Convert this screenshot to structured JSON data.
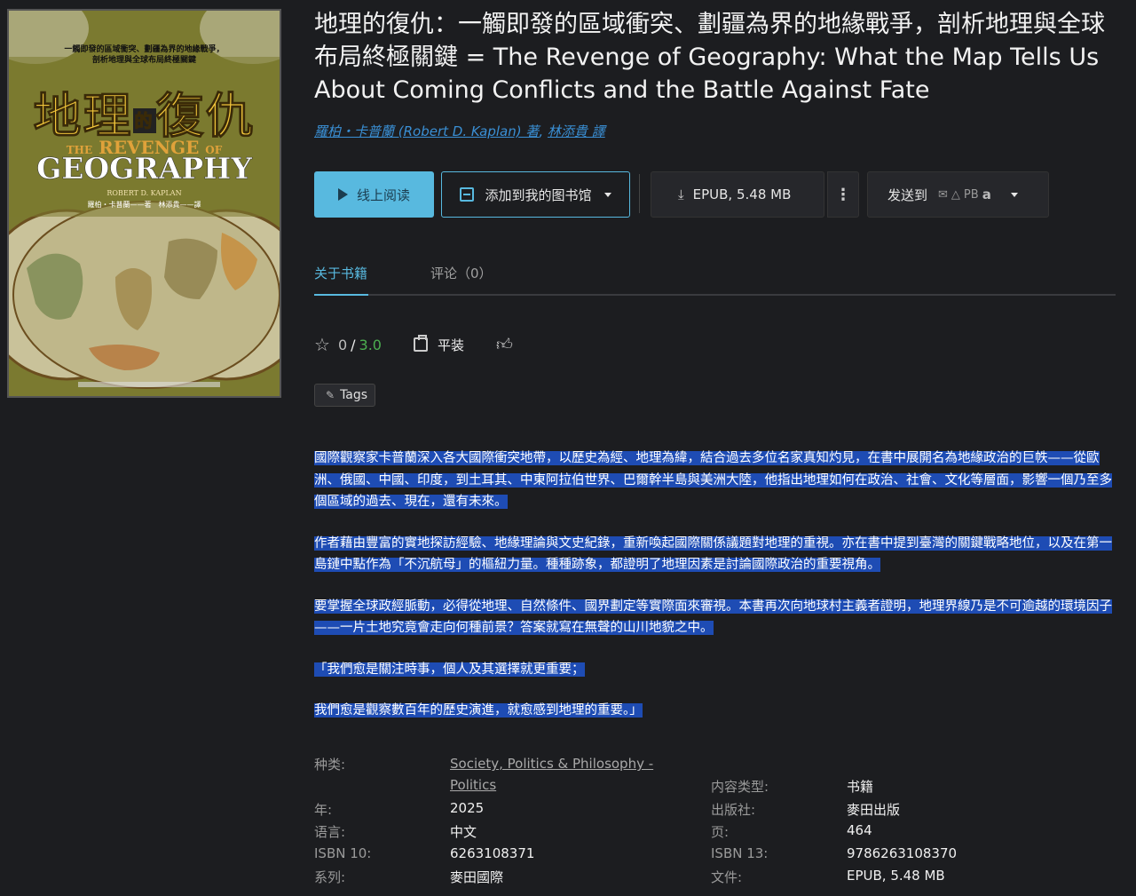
{
  "book": {
    "title": "地理的復仇：一觸即發的區域衝突、劃疆為界的地緣戰爭，剖析地理與全球布局終極關鍵 = The Revenge of Geography: What the Map Tells Us About Coming Conflicts and the Battle Against Fate",
    "authors": [
      "羅柏・卡普蘭 (Robert D. Kaplan) 著",
      "林添貴 譯"
    ]
  },
  "cover": {
    "tagline_1": "一觸即發的區域衝突、劃疆為界的地緣戰爭，",
    "tagline_2": "剖析地理與全球布局終極關鍵",
    "title_cn_a": "地理",
    "title_cn_de": "的",
    "title_cn_b": "復仇",
    "the": "THE",
    "revenge": "REVENGE",
    "of": "OF",
    "geography": "GEOGRAPHY",
    "author_en": "ROBERT D. KAPLAN",
    "author_cn": "羅柏・卡普蘭——著　林添貴——譯"
  },
  "actions": {
    "read_online": "线上阅读",
    "add_to_library": "添加到我的图书馆",
    "download": "EPUB, 5.48 MB",
    "send_to": "发送到",
    "send_pb": "PB",
    "send_amazon": "a"
  },
  "tabs": {
    "about": "关于书籍",
    "reviews": "评论（0）"
  },
  "rating": {
    "value": "0",
    "separator": "/",
    "max": "3.0"
  },
  "format": "平装",
  "tags_label": "Tags",
  "description": [
    "國際觀察家卡普蘭深入各大國際衝突地帶，以歷史為經、地理為緯，結合過去多位名家真知灼見，在書中展開名為地緣政治的巨帙——從歐洲、俄國、中國、印度，到土耳其、中東阿拉伯世界、巴爾幹半島與美洲大陸，他指出地理如何在政治、社會、文化等層面，影響一個乃至多個區域的過去、現在，還有未來。",
    "作者藉由豐富的實地探訪經驗、地緣理論與文史紀錄，重新喚起國際關係議題對地理的重視。亦在書中提到臺灣的關鍵戰略地位，以及在第一島鏈中點作為「不沉航母」的樞紐力量。種種跡象，都證明了地理因素是討論國際政治的重要視角。",
    "要掌握全球政經脈動，必得從地理、自然條件、國界劃定等實際面來審視。本書再次向地球村主義者證明，地理界線乃是不可逾越的環境因子——一片土地究竟會走向何種前景？答案就寫在無聲的山川地貌之中。",
    "「我們愈是關注時事，個人及其選擇就更重要；",
    "我們愈是觀察數百年的歷史演進，就愈感到地理的重要。」"
  ],
  "details": {
    "category_label": "种类:",
    "category_value": "Society, Politics & Philosophy - Politics",
    "content_type_label": "内容类型:",
    "content_type_value": "书籍",
    "year_label": "年:",
    "year_value": "2025",
    "publisher_label": "出版社:",
    "publisher_value": "麥田出版",
    "language_label": "语言:",
    "language_value": "中文",
    "pages_label": "页:",
    "pages_value": "464",
    "isbn10_label": "ISBN 10:",
    "isbn10_value": "6263108371",
    "isbn13_label": "ISBN 13:",
    "isbn13_value": "9786263108370",
    "series_label": "系列:",
    "series_value": "麥田國際",
    "file_label": "文件:",
    "file_value": "EPUB, 5.48 MB"
  },
  "colors": {
    "accent": "#58b9df",
    "selection": "#1e4cb4",
    "rating_max": "#4caf50",
    "background": "#1c1d20"
  }
}
